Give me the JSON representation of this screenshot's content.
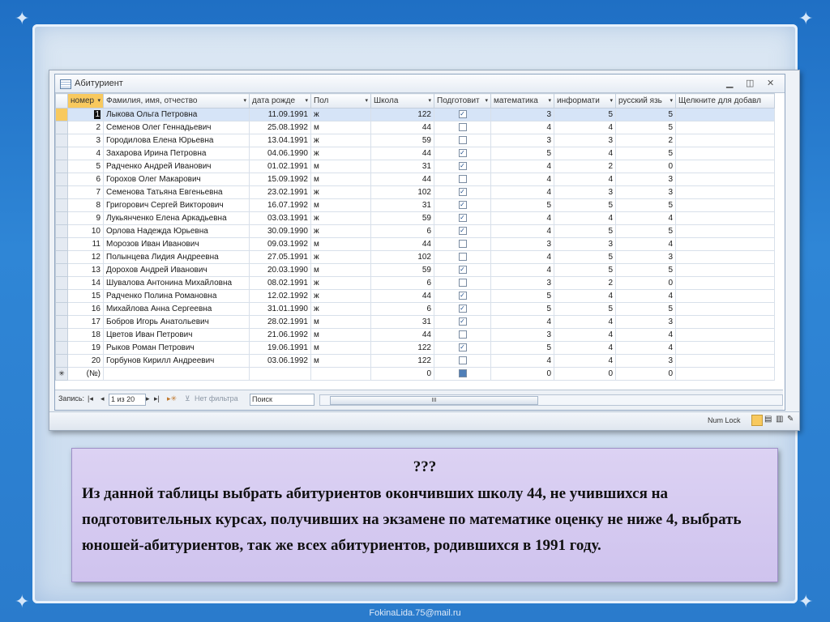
{
  "window": {
    "title": "Абитуриент"
  },
  "table": {
    "columns": [
      {
        "label": "номер",
        "key": "n"
      },
      {
        "label": "Фамилия, имя, отчество",
        "key": "fio"
      },
      {
        "label": "дата рожде",
        "key": "date"
      },
      {
        "label": "Пол",
        "key": "sex"
      },
      {
        "label": "Школа",
        "key": "school"
      },
      {
        "label": "Подготовит",
        "key": "prep"
      },
      {
        "label": "математика",
        "key": "math"
      },
      {
        "label": "информати",
        "key": "inf"
      },
      {
        "label": "русский язь",
        "key": "rus"
      },
      {
        "label": "Щелкните для добавл",
        "key": "add"
      }
    ],
    "rows": [
      {
        "n": "1",
        "fio": "Лыкова Ольга Петровна",
        "date": "11.09.1991",
        "sex": "ж",
        "school": "122",
        "prep": true,
        "math": "3",
        "inf": "5",
        "rus": "5"
      },
      {
        "n": "2",
        "fio": "Семенов Олег Геннадьевич",
        "date": "25.08.1992",
        "sex": "м",
        "school": "44",
        "prep": false,
        "math": "4",
        "inf": "4",
        "rus": "5"
      },
      {
        "n": "3",
        "fio": "Городилова Елена Юрьевна",
        "date": "13.04.1991",
        "sex": "ж",
        "school": "59",
        "prep": false,
        "math": "3",
        "inf": "3",
        "rus": "2"
      },
      {
        "n": "4",
        "fio": "Захарова Ирина Петровна",
        "date": "04.06.1990",
        "sex": "ж",
        "school": "44",
        "prep": true,
        "math": "5",
        "inf": "4",
        "rus": "5"
      },
      {
        "n": "5",
        "fio": "Радченко Андрей Иванович",
        "date": "01.02.1991",
        "sex": "м",
        "school": "31",
        "prep": true,
        "math": "4",
        "inf": "2",
        "rus": "0"
      },
      {
        "n": "6",
        "fio": "Горохов Олег Макарович",
        "date": "15.09.1992",
        "sex": "м",
        "school": "44",
        "prep": false,
        "math": "4",
        "inf": "4",
        "rus": "3"
      },
      {
        "n": "7",
        "fio": "Семенова Татьяна Евгеньевна",
        "date": "23.02.1991",
        "sex": "ж",
        "school": "102",
        "prep": true,
        "math": "4",
        "inf": "3",
        "rus": "3"
      },
      {
        "n": "8",
        "fio": "Григорович Сергей Викторович",
        "date": "16.07.1992",
        "sex": "м",
        "school": "31",
        "prep": true,
        "math": "5",
        "inf": "5",
        "rus": "5"
      },
      {
        "n": "9",
        "fio": "Лукьянченко Елена Аркадьевна",
        "date": "03.03.1991",
        "sex": "ж",
        "school": "59",
        "prep": true,
        "math": "4",
        "inf": "4",
        "rus": "4"
      },
      {
        "n": "10",
        "fio": "Орлова Надежда Юрьевна",
        "date": "30.09.1990",
        "sex": "ж",
        "school": "6",
        "prep": true,
        "math": "4",
        "inf": "5",
        "rus": "5"
      },
      {
        "n": "11",
        "fio": "Морозов Иван Иванович",
        "date": "09.03.1992",
        "sex": "м",
        "school": "44",
        "prep": false,
        "math": "3",
        "inf": "3",
        "rus": "4"
      },
      {
        "n": "12",
        "fio": "Полынцева Лидия Андреевна",
        "date": "27.05.1991",
        "sex": "ж",
        "school": "102",
        "prep": false,
        "math": "4",
        "inf": "5",
        "rus": "3"
      },
      {
        "n": "13",
        "fio": "Дорохов Андрей Иванович",
        "date": "20.03.1990",
        "sex": "м",
        "school": "59",
        "prep": true,
        "math": "4",
        "inf": "5",
        "rus": "5"
      },
      {
        "n": "14",
        "fio": "Шувалова Антонина Михайловна",
        "date": "08.02.1991",
        "sex": "ж",
        "school": "6",
        "prep": false,
        "math": "3",
        "inf": "2",
        "rus": "0"
      },
      {
        "n": "15",
        "fio": "Радченко Полина Романовна",
        "date": "12.02.1992",
        "sex": "ж",
        "school": "44",
        "prep": true,
        "math": "5",
        "inf": "4",
        "rus": "4"
      },
      {
        "n": "16",
        "fio": "Михайлова Анна Сергеевна",
        "date": "31.01.1990",
        "sex": "ж",
        "school": "6",
        "prep": true,
        "math": "5",
        "inf": "5",
        "rus": "5"
      },
      {
        "n": "17",
        "fio": "Бобров Игорь Анатольевич",
        "date": "28.02.1991",
        "sex": "м",
        "school": "31",
        "prep": true,
        "math": "4",
        "inf": "4",
        "rus": "3"
      },
      {
        "n": "18",
        "fio": "Цветов Иван Петрович",
        "date": "21.06.1992",
        "sex": "м",
        "school": "44",
        "prep": false,
        "math": "3",
        "inf": "4",
        "rus": "4"
      },
      {
        "n": "19",
        "fio": "Рыков Роман Петрович",
        "date": "19.06.1991",
        "sex": "м",
        "school": "122",
        "prep": true,
        "math": "5",
        "inf": "4",
        "rus": "4"
      },
      {
        "n": "20",
        "fio": "Горбунов Кирилл Андреевич",
        "date": "03.06.1992",
        "sex": "м",
        "school": "122",
        "prep": false,
        "math": "4",
        "inf": "4",
        "rus": "3"
      }
    ],
    "new_row": {
      "marker": "✳",
      "n": "(№)",
      "school": "0",
      "math": "0",
      "inf": "0",
      "rus": "0"
    }
  },
  "navbar": {
    "records_label": "Запись:",
    "position": "1 из 20",
    "filter_label": "Нет фильтра",
    "search_label": "Поиск",
    "scroll_thumb": "III"
  },
  "status": {
    "numlock": "Num Lock"
  },
  "task": {
    "marker": "???",
    "text": " Из данной таблицы выбрать абитуриентов окончивших школу 44, не учившихся на подготовительных курсах, получивших на экзамене по математике оценку не ниже 4, выбрать юношей-абитуриентов,  так же всех абитуриентов, родившихся в 1991 году."
  },
  "footer": {
    "email": "FokinaLida.75@mail.ru"
  }
}
